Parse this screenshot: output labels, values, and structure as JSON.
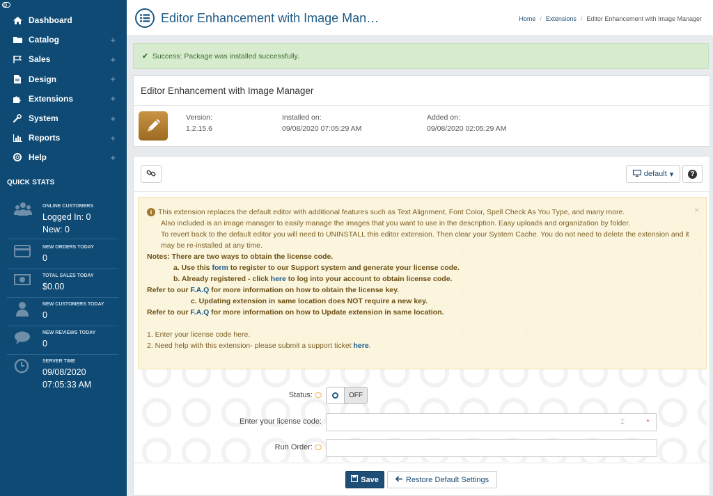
{
  "sidebar": {
    "items": [
      {
        "label": "Dashboard",
        "icon": "home-icon",
        "has_children": false
      },
      {
        "label": "Catalog",
        "icon": "folder-icon",
        "has_children": true
      },
      {
        "label": "Sales",
        "icon": "flag-icon",
        "has_children": true
      },
      {
        "label": "Design",
        "icon": "file-icon",
        "has_children": true
      },
      {
        "label": "Extensions",
        "icon": "puzzle-icon",
        "has_children": true
      },
      {
        "label": "System",
        "icon": "wrench-icon",
        "has_children": true
      },
      {
        "label": "Reports",
        "icon": "bar-chart-icon",
        "has_children": true
      },
      {
        "label": "Help",
        "icon": "lifebuoy-icon",
        "has_children": true
      }
    ],
    "plus_glyph": "+",
    "quick_stats_title": "QUICK STATS",
    "stats": {
      "online_customers": {
        "label": "ONLINE CUSTOMERS",
        "line1": "Logged In: 0",
        "line2": "New: 0"
      },
      "new_orders": {
        "label": "NEW ORDERS TODAY",
        "value": "0"
      },
      "total_sales": {
        "label": "TOTAL SALES TODAY",
        "value": "$0.00"
      },
      "new_customers": {
        "label": "NEW CUSTOMERS TODAY",
        "value": "0"
      },
      "new_reviews": {
        "label": "NEW REVIEWS TODAY",
        "value": "0"
      },
      "server_time": {
        "label": "SERVER TIME",
        "date": "09/08/2020",
        "time": "07:05:33 AM"
      }
    }
  },
  "header": {
    "title": "Editor Enhancement with Image Man…",
    "breadcrumb": [
      "Home",
      "Extensions",
      "Editor Enhancement with Image Manager"
    ],
    "breadcrumb_sep": "/"
  },
  "success_alert": {
    "text": "Success: Package was installed successfully."
  },
  "extension_info": {
    "name": "Editor Enhancement with Image Manager",
    "version_label": "Version:",
    "version": "1.2.15.6",
    "installed_label": "Installed on:",
    "installed": "09/08/2020 07:05:29 AM",
    "added_label": "Added on:",
    "added": "09/08/2020 02:05:29 AM"
  },
  "toolbar": {
    "profile_label": "default",
    "caret": "▾",
    "help_glyph": "?"
  },
  "info_alert": {
    "close_glyph": "×",
    "p1": "This extension replaces the default editor with additional features such as Text Alignment, Font Color, Spell Check As You Type, and many more.",
    "p2": "Also included is an image manager to easily manage the images that you want to use in the description. Easy uploads and organization by folder.",
    "p3": "To revert back to the default editor you will need to UNINSTALL this editor extension. Then clear your System Cache. You do not need to delete the extension and it may be re-installed at any time.",
    "notes": "Notes: There are two ways to obtain the license code.",
    "a_pre": "a. Use this ",
    "a_link": "form",
    "a_post": " to register to our Support system and generate your license code.",
    "b_pre": "b. Already registered - click ",
    "b_link": "here",
    "b_post": " to log into your account to obtain license code.",
    "faq1_pre": "Refer to our ",
    "faq1_link": "F.A.Q",
    "faq1_post": " for more information on how to obtain the license key.",
    "c": "c. Updating extension in same location does NOT require a new key.",
    "faq2_pre": "Refer to our ",
    "faq2_link": "F.A.Q",
    "faq2_post": " for more information on how to Update extension in same location.",
    "step1": "1. Enter your license code here.",
    "step2_pre": "2. Need help with this extension- please submit a support ticket ",
    "step2_link": "here",
    "step2_post": "."
  },
  "form": {
    "status_label": "Status:",
    "status_value": "OFF",
    "license_label": "Enter your license code:",
    "license_value": "",
    "required_glyph": "*",
    "run_order_label": "Run Order:",
    "run_order_value": ""
  },
  "actions": {
    "save_label": "Save",
    "restore_label": "Restore Default Settings"
  }
}
